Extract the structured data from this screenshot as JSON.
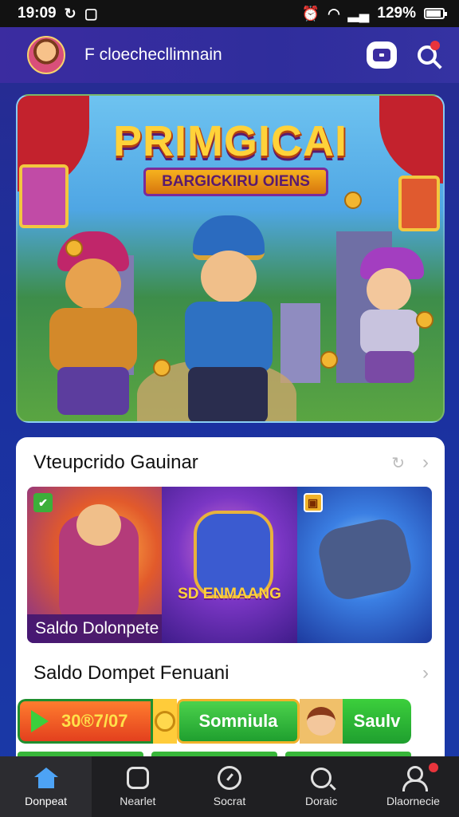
{
  "status_bar": {
    "time": "19:09",
    "battery": "129%",
    "battery_level": 0.9
  },
  "app_bar": {
    "title": "F cloechecllimnain",
    "avatar_icon": "user-avatar",
    "chat_icon": "chat-icon",
    "search_icon": "search-icon",
    "has_notification": true
  },
  "hero": {
    "title": "PRIMGICAI",
    "subtitle": "BARGICKIRU OIENS"
  },
  "section1": {
    "title": "Vteupcrido Gauinar",
    "tiles": [
      {
        "badge": "✔",
        "caption": "Saldo Dolonpete"
      },
      {
        "label": "SD ENMAANG"
      },
      {
        "badge": "▣"
      }
    ]
  },
  "section2": {
    "title": "Saldo Dompet Fenuani",
    "amount": "30®7/07",
    "mid_label": "Somniula",
    "right_label": "Saulv"
  },
  "bottom_nav": {
    "items": [
      {
        "label": "Donpeat",
        "icon": "home-icon",
        "active": true
      },
      {
        "label": "Nearlet",
        "icon": "box-icon"
      },
      {
        "label": "Socrat",
        "icon": "clock-icon"
      },
      {
        "label": "Doraic",
        "icon": "search-icon"
      },
      {
        "label": "Dlaornecie",
        "icon": "user-icon"
      }
    ]
  },
  "colors": {
    "accent": "#4da3f5",
    "appbar": "#3b2ca0",
    "notification": "#e8343c"
  }
}
